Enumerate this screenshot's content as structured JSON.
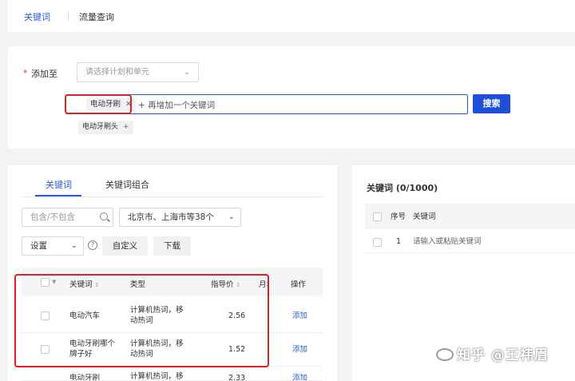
{
  "top_tabs": [
    "关键词",
    "流量查询"
  ],
  "add_section": {
    "label": "添加至",
    "required_mark": "*",
    "select_placeholder": "请选择计划和单元",
    "keyword_chip": "电动牙刷",
    "input_placeholder": "+ 再增加一个关键词",
    "search_button": "搜索",
    "suggestion_chip": "电动牙刷头"
  },
  "left_panel": {
    "tabs": [
      "关键词",
      "关键词组合"
    ],
    "filter_placeholder": "包含/不包含",
    "region_select": "北京市、上海市等38个",
    "settings_select": "设置",
    "help_icon": "?",
    "customize_button": "自定义",
    "download_button": "下载",
    "table": {
      "columns": [
        "关键词",
        "类型",
        "指导价",
        "月均",
        "操作"
      ],
      "rows": [
        {
          "keyword": "电动汽车",
          "type": "计算机热词，移动热词",
          "price": "2.56",
          "action": "添加"
        },
        {
          "keyword": "电动牙刷哪个牌子好",
          "type": "计算机热词，移动热词",
          "price": "1.52",
          "action": "添加"
        },
        {
          "keyword": "电动牙刷",
          "type": "计算机热词，移",
          "price": "2.33",
          "action": "添加"
        }
      ]
    }
  },
  "right_panel": {
    "title": "关键词 (0/1000)",
    "columns": [
      "序号",
      "关键词"
    ],
    "row_index": "1",
    "row_placeholder": "请输入或粘贴关键词"
  },
  "watermark": "知乎 @王祎眉",
  "colors": {
    "accent": "#2a5bd7",
    "highlight_border": "#e02020"
  }
}
